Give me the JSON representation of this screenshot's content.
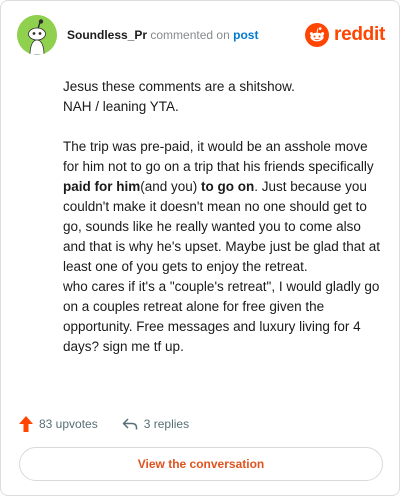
{
  "header": {
    "username": "Soundless_Pr",
    "commented_on": "commented on",
    "post_link": "post",
    "brand": "reddit"
  },
  "comment": {
    "line1": "Jesus these comments are a shitshow.",
    "line2": "NAH / leaning YTA.",
    "para2_a": "The trip was pre-paid, it would be an asshole move for him not to go on a trip that his friends specifically ",
    "para2_bold1": "paid for him",
    "para2_b": "(and you) ",
    "para2_bold2": "to go on",
    "para2_c": ". Just because you couldn't make it doesn't mean no one should get to go, sounds like he really wanted you to come also and that is why he's upset. Maybe just be glad that at least one of you gets to enjoy the retreat.",
    "para3": "who cares if it's a \"couple's retreat\", I would gladly go on a couples retreat alone for free given the opportunity. Free messages and luxury living for 4 days? sign me tf up."
  },
  "actions": {
    "upvotes": "83 upvotes",
    "replies": "3 replies"
  },
  "view_button": "View the conversation",
  "colors": {
    "brand": "#ff4500",
    "link": "#0079d3",
    "avatar": "#8fd14f",
    "button_text": "#e0531f"
  }
}
